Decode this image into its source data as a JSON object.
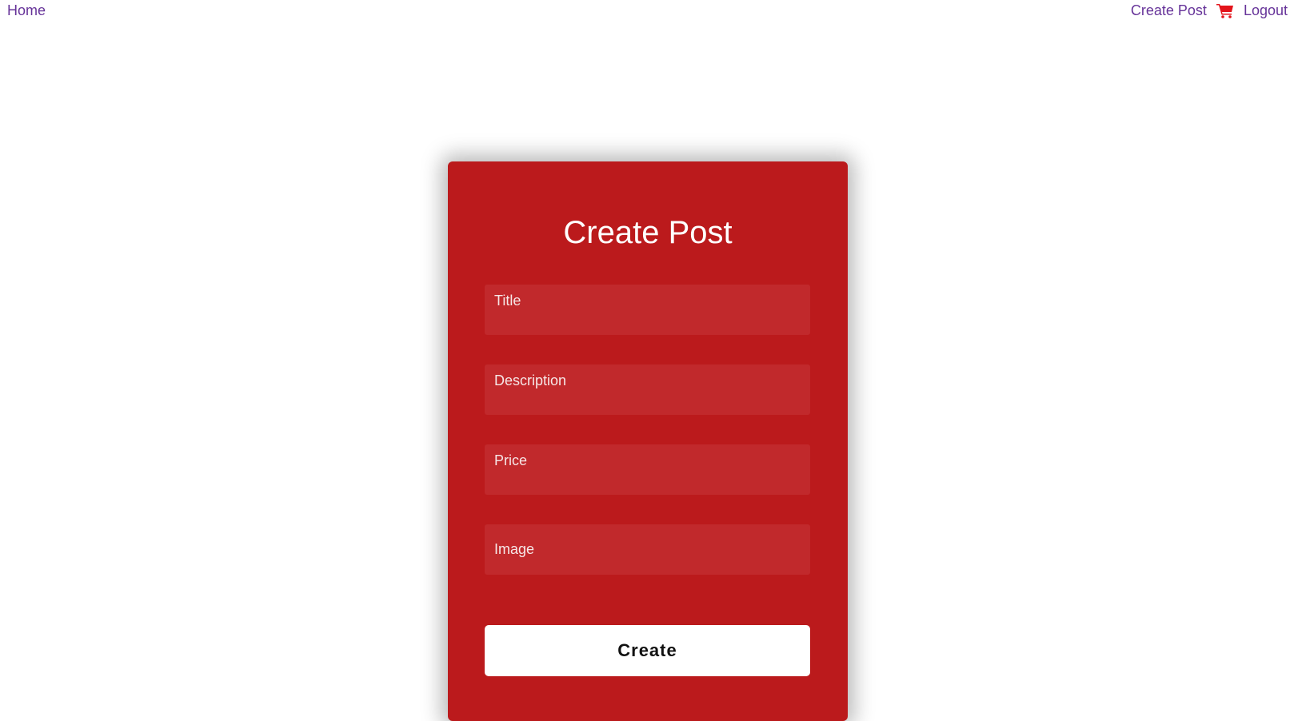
{
  "nav": {
    "home_label": "Home",
    "create_post_label": "Create Post",
    "cart_icon": "shopping-cart-icon",
    "logout_label": "Logout",
    "link_color": "#663399",
    "cart_color": "#e3141b"
  },
  "form": {
    "title": "Create Post",
    "fields": [
      {
        "label": "Title",
        "value": ""
      },
      {
        "label": "Description",
        "value": ""
      },
      {
        "label": "Price",
        "value": ""
      },
      {
        "label": "Image",
        "value": ""
      }
    ],
    "submit_label": "Create",
    "card_color": "#bb1a1c",
    "field_color": "#c1292c"
  }
}
